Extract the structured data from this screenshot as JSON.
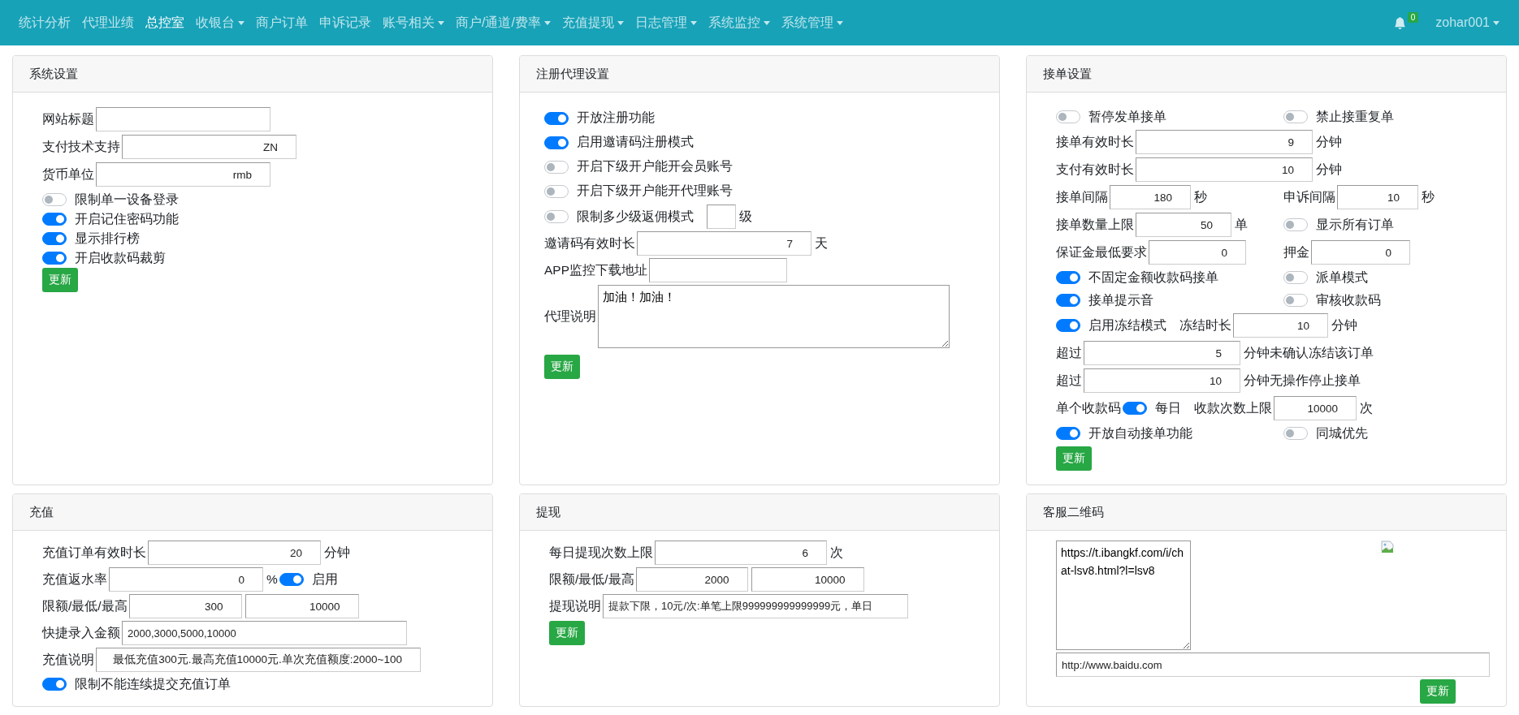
{
  "navbar": {
    "items": [
      {
        "label": "统计分析",
        "selected": false,
        "dropdown": false
      },
      {
        "label": "代理业绩",
        "selected": false,
        "dropdown": false
      },
      {
        "label": "总控室",
        "selected": true,
        "dropdown": false
      },
      {
        "label": "收银台",
        "selected": false,
        "dropdown": true
      },
      {
        "label": "商户订单",
        "selected": false,
        "dropdown": false
      },
      {
        "label": "申诉记录",
        "selected": false,
        "dropdown": false
      },
      {
        "label": "账号相关",
        "selected": false,
        "dropdown": true
      },
      {
        "label": "商户/通道/费率",
        "selected": false,
        "dropdown": true
      },
      {
        "label": "充值提现",
        "selected": false,
        "dropdown": true
      },
      {
        "label": "日志管理",
        "selected": false,
        "dropdown": true
      },
      {
        "label": "系统监控",
        "selected": false,
        "dropdown": true
      },
      {
        "label": "系统管理",
        "selected": false,
        "dropdown": true
      }
    ],
    "notifications": "0",
    "user": "zohar001"
  },
  "panels": [
    {
      "title": "系统设置",
      "rows": [
        [
          [
            {
              "kind": "label",
              "text": "网站标题"
            },
            {
              "kind": "input"
            }
          ]
        ],
        [
          [
            {
              "kind": "label",
              "text": "支付技术支持"
            },
            {
              "kind": "input",
              "value": "ZN"
            }
          ]
        ],
        [
          [
            {
              "kind": "label",
              "text": "货币单位"
            },
            {
              "kind": "input",
              "value": "rmb"
            }
          ]
        ],
        [
          [
            {
              "kind": "toggle",
              "on": false,
              "text": "限制单一设备登录"
            }
          ]
        ],
        [
          [
            {
              "kind": "toggle",
              "on": true,
              "text": "开启记住密码功能"
            }
          ]
        ],
        [
          [
            {
              "kind": "toggle",
              "on": true,
              "text": "显示排行榜"
            }
          ]
        ],
        [
          [
            {
              "kind": "toggle",
              "on": true,
              "text": "开启收款码裁剪"
            }
          ]
        ],
        [
          [
            {
              "kind": "button",
              "label": "更新"
            }
          ]
        ]
      ]
    },
    {
      "title": "注册代理设置",
      "rows": [
        [
          [
            {
              "kind": "toggle",
              "on": true,
              "text": "开放注册功能"
            }
          ]
        ],
        [
          [
            {
              "kind": "toggle",
              "on": true,
              "text": "启用邀请码注册模式"
            }
          ]
        ],
        [
          [
            {
              "kind": "toggle",
              "on": false,
              "text": "开启下级开户能开会员账号"
            }
          ]
        ],
        [
          [
            {
              "kind": "toggle",
              "on": false,
              "text": "开启下级开户能开代理账号"
            }
          ]
        ],
        [
          [
            {
              "kind": "toggle",
              "on": false,
              "text": "限制多少级返佣模式"
            },
            {
              "kind": "input"
            },
            {
              "kind": "label",
              "text": "级"
            }
          ]
        ],
        [
          [
            {
              "kind": "label",
              "text": "邀请码有效时长"
            },
            {
              "kind": "input",
              "value": "7"
            },
            {
              "kind": "label",
              "text": "天"
            }
          ]
        ],
        [
          [
            {
              "kind": "label",
              "text": "APP监控下载地址"
            },
            {
              "kind": "input"
            }
          ]
        ],
        [
          [
            {
              "kind": "label",
              "text": "代理说明"
            },
            {
              "kind": "textarea",
              "value": "加油！加油！"
            }
          ]
        ],
        [
          [
            {
              "kind": "button",
              "label": "更新"
            }
          ]
        ]
      ]
    },
    {
      "title": "接单设置",
      "rows": [
        [
          [
            {
              "kind": "toggle",
              "on": false,
              "text": "暂停发单接单"
            }
          ],
          [
            {
              "kind": "toggle",
              "on": false,
              "text": "禁止接重复单"
            }
          ]
        ],
        [
          [
            {
              "kind": "label",
              "text": "接单有效时长"
            },
            {
              "kind": "input",
              "value": "9"
            },
            {
              "kind": "label",
              "text": "分钟"
            }
          ]
        ],
        [
          [
            {
              "kind": "label",
              "text": "支付有效时长"
            },
            {
              "kind": "input",
              "value": "10"
            },
            {
              "kind": "label",
              "text": "分钟"
            }
          ]
        ],
        [
          [
            {
              "kind": "label",
              "text": "接单间隔"
            },
            {
              "kind": "input",
              "value": "180"
            },
            {
              "kind": "label",
              "text": "秒"
            }
          ],
          [
            {
              "kind": "label",
              "text": "申诉间隔"
            },
            {
              "kind": "input",
              "value": "10"
            },
            {
              "kind": "label",
              "text": "秒"
            }
          ]
        ],
        [
          [
            {
              "kind": "label",
              "text": "接单数量上限"
            },
            {
              "kind": "input",
              "value": "50"
            },
            {
              "kind": "label",
              "text": "单"
            }
          ],
          [
            {
              "kind": "toggle",
              "on": false,
              "text": "显示所有订单"
            }
          ]
        ],
        [
          [
            {
              "kind": "label",
              "text": "保证金最低要求"
            },
            {
              "kind": "input",
              "value": "0"
            }
          ],
          [
            {
              "kind": "label",
              "text": "押金"
            },
            {
              "kind": "input",
              "value": "0"
            }
          ]
        ],
        [
          [
            {
              "kind": "toggle",
              "on": true,
              "text": "不固定金额收款码接单"
            }
          ],
          [
            {
              "kind": "toggle",
              "on": false,
              "text": "派单模式"
            }
          ]
        ],
        [
          [
            {
              "kind": "toggle",
              "on": true,
              "text": "接单提示音"
            }
          ],
          [
            {
              "kind": "toggle",
              "on": false,
              "text": "审核收款码"
            }
          ]
        ],
        [
          [
            {
              "kind": "toggle",
              "on": true,
              "text": "启用冻结模式"
            },
            {
              "kind": "label",
              "text": "冻结时长"
            },
            {
              "kind": "input",
              "value": "10"
            },
            {
              "kind": "label",
              "text": "分钟"
            }
          ]
        ],
        [
          [
            {
              "kind": "label",
              "text": "超过"
            },
            {
              "kind": "input",
              "value": "5"
            },
            {
              "kind": "label",
              "text": "分钟未确认冻结该订单"
            }
          ]
        ],
        [
          [
            {
              "kind": "label",
              "text": "超过"
            },
            {
              "kind": "input",
              "value": "10"
            },
            {
              "kind": "label",
              "text": "分钟无操作停止接单"
            }
          ]
        ],
        [
          [
            {
              "kind": "label",
              "text": "单个收款码"
            },
            {
              "kind": "toggle",
              "on": true,
              "text": "每日"
            },
            {
              "kind": "label",
              "text": "收款次数上限"
            },
            {
              "kind": "input",
              "value": "10000"
            },
            {
              "kind": "label",
              "text": "次"
            }
          ]
        ],
        [
          [
            {
              "kind": "toggle",
              "on": true,
              "text": "开放自动接单功能"
            }
          ],
          [
            {
              "kind": "toggle",
              "on": false,
              "text": "同城优先"
            }
          ]
        ],
        [
          [
            {
              "kind": "button",
              "label": "更新"
            }
          ]
        ]
      ]
    },
    {
      "title": "充值",
      "rows": [
        [
          [
            {
              "kind": "label",
              "text": "充值订单有效时长"
            },
            {
              "kind": "input",
              "value": "20"
            },
            {
              "kind": "label",
              "text": "分钟"
            }
          ]
        ],
        [
          [
            {
              "kind": "label",
              "text": "充值返水率"
            },
            {
              "kind": "input",
              "value": "0"
            },
            {
              "kind": "label",
              "text": "%"
            },
            {
              "kind": "toggle",
              "on": true,
              "text": "启用"
            }
          ]
        ],
        [
          [
            {
              "kind": "label",
              "text": "限额/最低/最高"
            },
            {
              "kind": "input",
              "value": "300"
            },
            {
              "kind": "input",
              "value": "10000"
            }
          ]
        ],
        [
          [
            {
              "kind": "label",
              "text": "快捷录入金额"
            },
            {
              "kind": "input",
              "value": "2000,3000,5000,10000"
            }
          ]
        ],
        [
          [
            {
              "kind": "label",
              "text": "充值说明"
            },
            {
              "kind": "input",
              "value": "最低充值300元.最高充值10000元.单次充值额度:2000~100"
            }
          ]
        ],
        [
          [
            {
              "kind": "toggle",
              "on": true,
              "text": "限制不能连续提交充值订单"
            }
          ]
        ]
      ]
    },
    {
      "title": "提现",
      "rows": [
        [
          [
            {
              "kind": "label",
              "text": "每日提现次数上限"
            },
            {
              "kind": "input",
              "value": "6"
            },
            {
              "kind": "label",
              "text": "次"
            }
          ]
        ],
        [
          [
            {
              "kind": "label",
              "text": "限额/最低/最高"
            },
            {
              "kind": "input",
              "value": "2000"
            },
            {
              "kind": "input",
              "value": "10000"
            }
          ]
        ],
        [
          [
            {
              "kind": "label",
              "text": "提现说明"
            },
            {
              "kind": "input",
              "value": "提款下限，10元/次:单笔上限999999999999999元，单日"
            }
          ]
        ],
        [
          [
            {
              "kind": "button",
              "label": "更新"
            }
          ]
        ]
      ]
    },
    {
      "title": "客服二维码",
      "rows": [
        [
          [
            {
              "kind": "textarea",
              "value": "https://t.ibangkf.com/i/chat-lsv8.html?l=lsv8"
            }
          ],
          [
            {
              "kind": "image"
            }
          ]
        ],
        [
          [
            {
              "kind": "input",
              "value": "http://www.baidu.com"
            }
          ]
        ],
        [
          [
            {
              "kind": "button",
              "label": "更新"
            }
          ]
        ]
      ]
    }
  ]
}
